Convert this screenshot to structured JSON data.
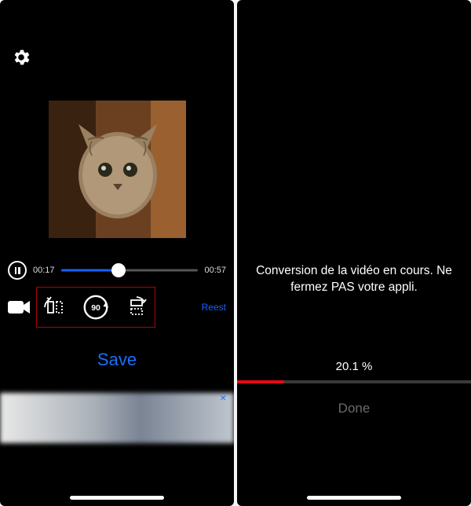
{
  "left": {
    "playback": {
      "current_time": "00:17",
      "total_time": "00:57",
      "position_pct": 42
    },
    "reset_label": "Reest",
    "save_label": "Save"
  },
  "right": {
    "message_line1": "Conversion de la vidéo en cours. Ne",
    "message_line2": "fermez PAS votre appli.",
    "percent_text": "20.1 %",
    "percent_value": 20.1,
    "done_label": "Done"
  }
}
